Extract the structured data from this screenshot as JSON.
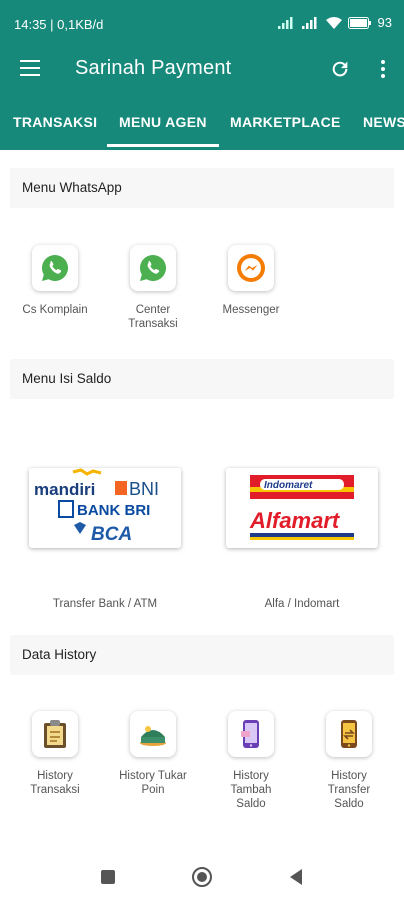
{
  "status": {
    "time": "14:35 | 0,1KB/d",
    "battery": "93"
  },
  "app": {
    "title": "Sarinah Payment"
  },
  "tabs": [
    {
      "label": "TRANSAKSI"
    },
    {
      "label": "MENU AGEN"
    },
    {
      "label": "MARKETPLACE"
    },
    {
      "label": "NEWS"
    }
  ],
  "whatsapp": {
    "title": "Menu WhatsApp",
    "items": [
      {
        "label": "Cs Komplain",
        "icon": "whatsapp-icon"
      },
      {
        "label": "Center\nTransaksi",
        "icon": "whatsapp-icon"
      },
      {
        "label": "Messenger",
        "icon": "messenger-icon"
      }
    ]
  },
  "topup": {
    "title": "Menu Isi Saldo",
    "items": [
      {
        "label": "Transfer Bank / ATM",
        "logo_text": [
          "mandiri",
          "BNI",
          "BANK BRI",
          "BCA"
        ]
      },
      {
        "label": "Alfa / Indomart",
        "logo_text": [
          "Indomaret",
          "Alfamart"
        ]
      }
    ]
  },
  "history": {
    "title": "Data History",
    "items": [
      {
        "label": "History\nTransaksi",
        "icon": "clipboard-icon"
      },
      {
        "label": "History Tukar\nPoin",
        "icon": "points-icon"
      },
      {
        "label": "History\nTambah\nSaldo",
        "icon": "phone-topup-icon"
      },
      {
        "label": "History\nTransfer\nSaldo",
        "icon": "phone-transfer-icon"
      }
    ]
  },
  "colors": {
    "primary": "#16897a",
    "whatsapp": "#4caf50",
    "messenger": "#f57c00"
  }
}
